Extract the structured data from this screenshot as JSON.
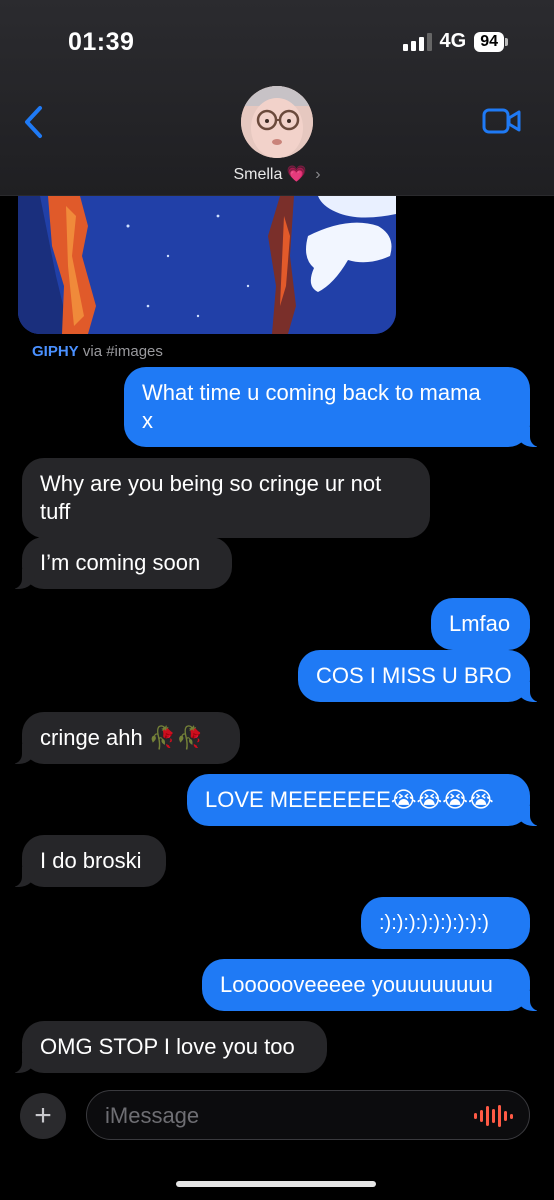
{
  "status": {
    "time": "01:39",
    "network": "4G",
    "battery": "94"
  },
  "header": {
    "contact_name": "Smella",
    "name_suffix": "💗",
    "chevron": "›"
  },
  "gif": {
    "brand": "GIPHY",
    "source": "via #images"
  },
  "messages": [
    {
      "text": "What time u coming back to mama\nx",
      "direction": "sent"
    },
    {
      "text": "Why are you being so cringe ur not\ntuff",
      "direction": "received"
    },
    {
      "text": "I’m coming soon",
      "direction": "received"
    },
    {
      "text": "Lmfao",
      "direction": "sent"
    },
    {
      "text": "COS I MISS U BRO",
      "direction": "sent"
    },
    {
      "text": "cringe ahh 🥀🥀",
      "direction": "received"
    },
    {
      "text": "LOVE MEEEEEEE😭😭😭😭",
      "direction": "sent"
    },
    {
      "text": "I do broski",
      "direction": "received"
    },
    {
      "text": ":):):):):):):):):)",
      "direction": "sent"
    },
    {
      "text": "Loooooveeeee youuuuuuuu",
      "direction": "sent"
    },
    {
      "text": "OMG STOP I love you too",
      "direction": "received"
    }
  ],
  "composer": {
    "placeholder": "iMessage",
    "plus": "+"
  },
  "colors": {
    "sent": "#1f7af5",
    "received": "#262629",
    "accent": "#1f7af5",
    "mic": "#ff5a45"
  },
  "icons": [
    "back-chevron-icon",
    "video-call-icon",
    "plus-icon",
    "audio-waveform-icon"
  ]
}
